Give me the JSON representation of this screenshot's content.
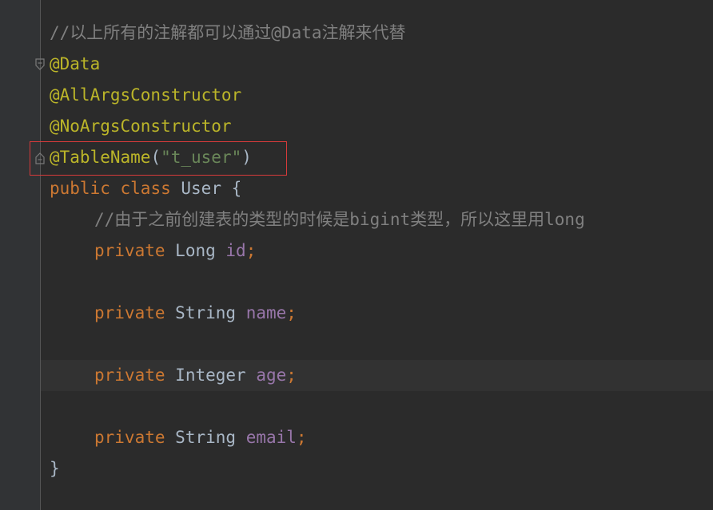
{
  "code": {
    "comment_top": "//以上所有的注解都可以通过@Data注解来代替",
    "ann_data": "@Data",
    "ann_all_args": "@AllArgsConstructor",
    "ann_no_args": "@NoArgsConstructor",
    "ann_table_name": "@TableName",
    "paren_open": "(",
    "table_name_value": "\"t_user\"",
    "paren_close": ")",
    "kw_public": "public",
    "kw_class": "class",
    "class_name": "User",
    "brace_open": "{",
    "comment_inner": "//由于之前创建表的类型的时候是bigint类型，所以这里用long",
    "kw_private": "private",
    "type_long": "Long",
    "field_id": "id",
    "type_string": "String",
    "field_name": "name",
    "type_integer": "Integer",
    "field_age": "age",
    "field_email": "email",
    "semicolon": ";",
    "brace_close": "}"
  },
  "colors": {
    "background": "#2b2b2b",
    "gutter": "#313335",
    "comment": "#808080",
    "annotation": "#bbb529",
    "string": "#6a8759",
    "keyword": "#cc7832",
    "field": "#9876aa",
    "plain": "#a9b7c6",
    "highlight_border": "#d63a3a"
  }
}
